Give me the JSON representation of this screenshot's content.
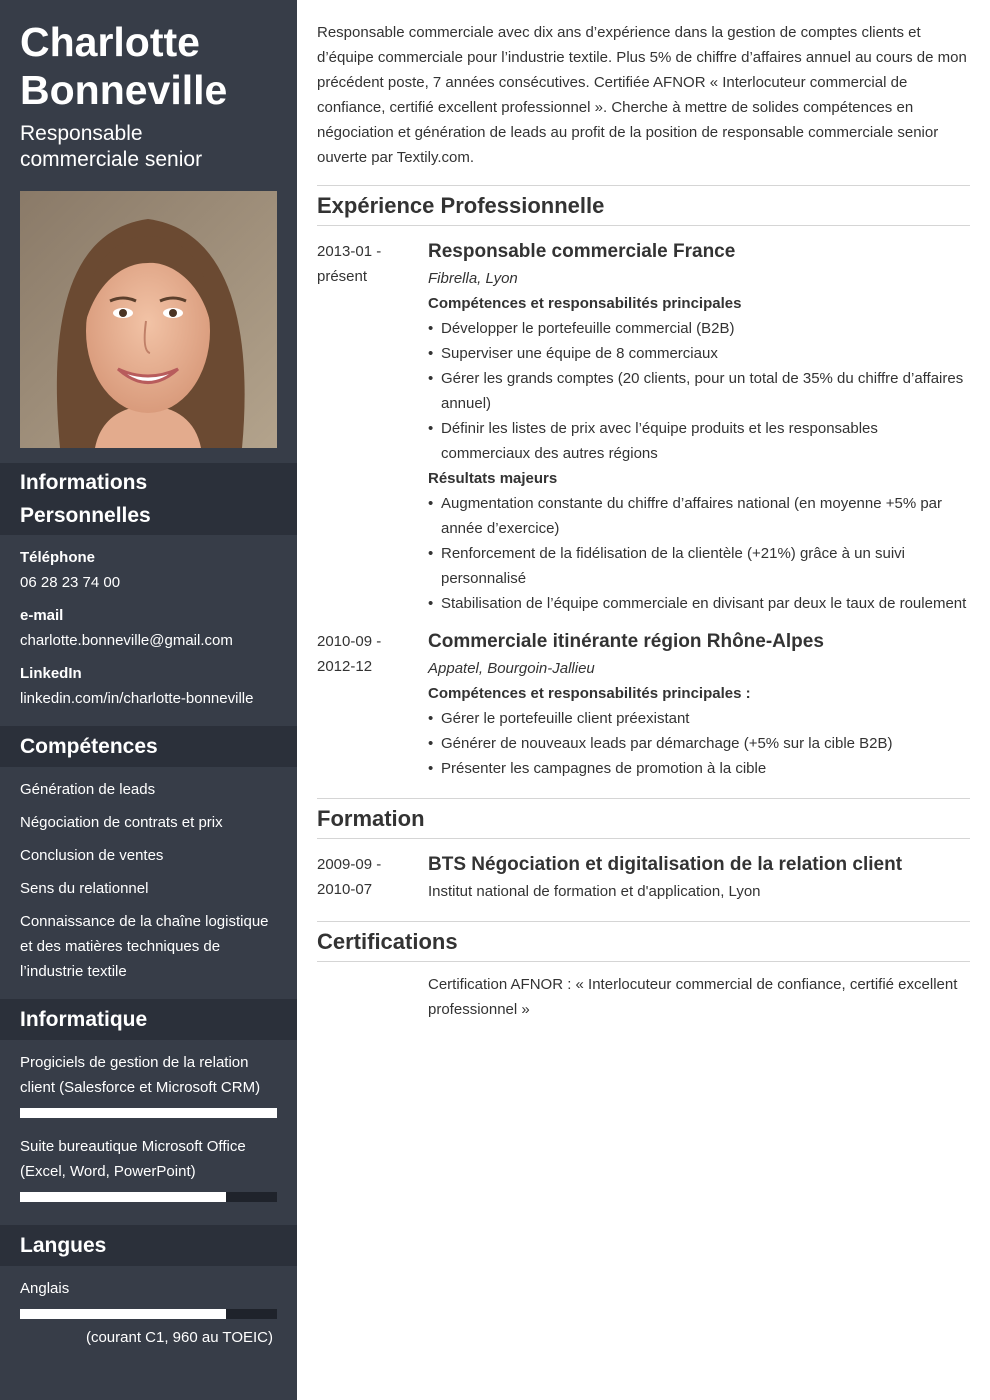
{
  "profile": {
    "name_line1": "Charlotte",
    "name_line2": "Bonneville",
    "title_line1": "Responsable",
    "title_line2": "commerciale senior",
    "photo_icon": "person-photo"
  },
  "personal": {
    "heading_line1": "Informations",
    "heading_line2": "Personnelles",
    "phone_label": "Téléphone",
    "phone": "06 28 23 74 00",
    "email_label": "e-mail",
    "email": "charlotte.bonneville@gmail.com",
    "linkedin_label": "LinkedIn",
    "linkedin": "linkedin.com/in/charlotte-bonneville"
  },
  "skills": {
    "heading": "Compétences",
    "items": [
      "Génération de leads",
      "Négociation de contrats et prix",
      "Conclusion de ventes",
      "Sens du relationnel",
      "Connaissance de la chaîne logistique et des matières techniques de l’industrie textile"
    ]
  },
  "it": {
    "heading": "Informatique",
    "items": [
      {
        "label": "Progiciels de gestion de la relation client (Salesforce et Microsoft CRM)",
        "level": 1.0
      },
      {
        "label": "Suite bureautique Microsoft Office (Excel, Word, PowerPoint)",
        "level": 0.8
      }
    ]
  },
  "languages": {
    "heading": "Langues",
    "items": [
      {
        "label": "Anglais",
        "level": 0.8,
        "note": "(courant C1, 960 au TOEIC)"
      }
    ]
  },
  "summary": "Responsable commerciale avec dix ans d’expérience dans la gestion de comptes clients et d’équipe commerciale pour l’industrie textile. Plus 5% de chiffre d’affaires annuel au cours de mon précédent poste, 7 années consécutives. Certifiée AFNOR « Interlocuteur commercial de confiance, certifié excellent professionnel ». Cherche à mettre de solides compétences en négociation et génération de leads au profit de la position de responsable commerciale senior ouverte par Textily.com.",
  "experience": {
    "heading": "Expérience Professionnelle",
    "jobs": [
      {
        "date_line1": "2013-01 -",
        "date_line2": "présent",
        "title": "Responsable commerciale France",
        "company": "Fibrella, Lyon",
        "sub1": "Compétences et responsabilités principales",
        "bullets1": [
          "Développer le portefeuille commercial (B2B)",
          "Superviser une équipe de 8 commerciaux",
          "Gérer les grands comptes (20 clients, pour un total de 35% du chiffre d’affaires annuel)",
          "Définir les listes de prix avec l’équipe produits et les responsables commerciaux des autres régions"
        ],
        "sub2": "Résultats majeurs",
        "bullets2": [
          "Augmentation constante du chiffre d’affaires national (en moyenne +5% par année d’exercice)",
          "Renforcement de la fidélisation de la clientèle (+21%) grâce à un suivi personnalisé",
          "Stabilisation de l’équipe commerciale en divisant par deux le taux de roulement"
        ]
      },
      {
        "date_line1": "2010-09 -",
        "date_line2": "2012-12",
        "title": "Commerciale itinérante région Rhône-Alpes",
        "company": "Appatel, Bourgoin-Jallieu",
        "sub1": "Compétences et responsabilités principales :",
        "bullets1": [
          "Gérer le portefeuille client préexistant",
          "Générer de nouveaux leads par démarchage (+5% sur la cible B2B)",
          "Présenter les campagnes de promotion à la cible"
        ]
      }
    ]
  },
  "education": {
    "heading": "Formation",
    "date_line1": "2009-09 -",
    "date_line2": "2010-07",
    "title": "BTS Négociation et digitalisation de la relation client",
    "school": "Institut national de formation et d'application, Lyon"
  },
  "certifications": {
    "heading": "Certifications",
    "text": "Certification AFNOR : « Interlocuteur commercial de confiance, certifié excellent professionnel »"
  }
}
